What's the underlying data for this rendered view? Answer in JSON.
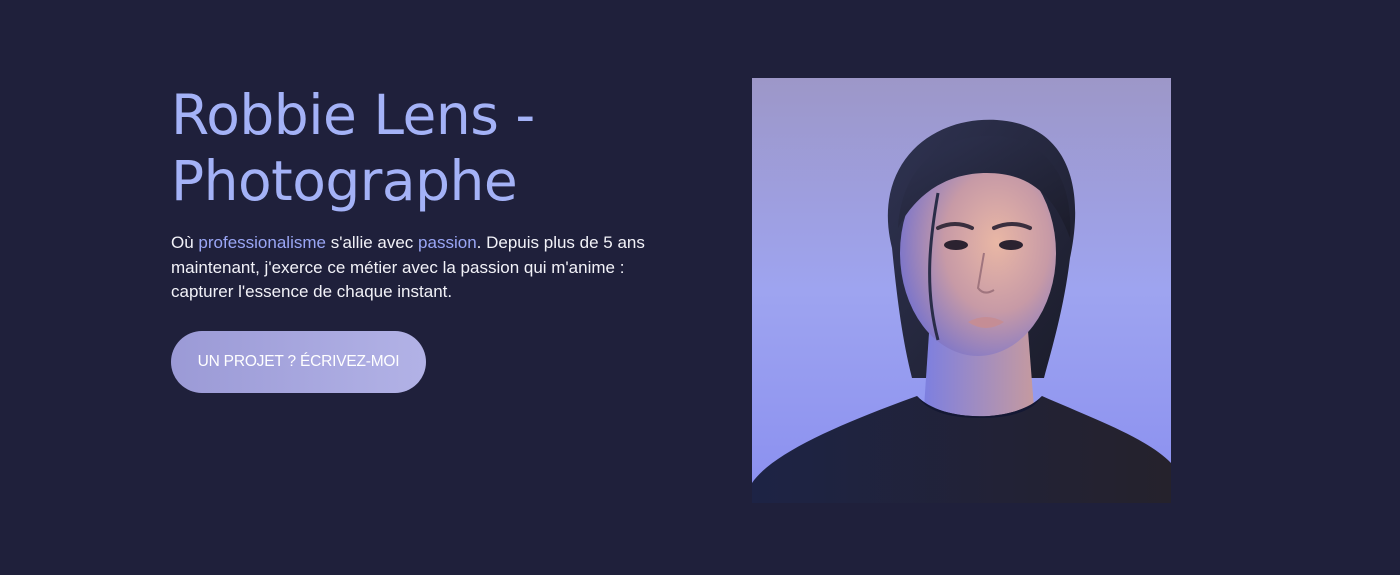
{
  "hero": {
    "title_line1": "Robbie Lens -",
    "title_line2": "Photographe",
    "intro": {
      "l1_pre": "Où ",
      "l1_accent1": "professionalisme",
      "l1_mid": " s'allie avec ",
      "l1_accent2": "passion",
      "l1_post": ". Depuis plus de 5 ans",
      "l2": "maintenant, j'exerce ce métier avec la passion qui m'anime :",
      "l3": "capturer l'essence de chaque instant."
    },
    "cta_label": "UN PROJET ? ÉCRIVEZ-MOI"
  },
  "colors": {
    "background": "#1f203b",
    "title": "#a4b2f7",
    "accent": "#9aa6f5",
    "button": "#a6a5dc"
  }
}
